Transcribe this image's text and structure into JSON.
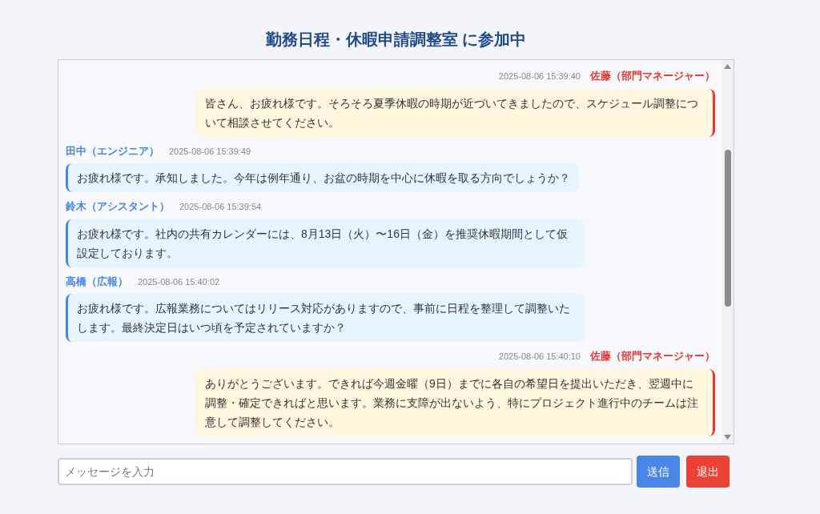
{
  "title": "勤務日程・休暇申請調整室 に参加中",
  "messages": [
    {
      "kind": "self",
      "sender": "佐藤（部門マネージャー）",
      "time": "2025-08-06 15:39:40",
      "text": "皆さん、お疲れ様です。そろそろ夏季休暇の時期が近づいてきましたので、スケジュール調整について相談させてください。"
    },
    {
      "kind": "other",
      "sender": "田中（エンジニア）",
      "time": "2025-08-06 15:39:49",
      "text": "お疲れ様です。承知しました。今年は例年通り、お盆の時期を中心に休暇を取る方向でしょうか？"
    },
    {
      "kind": "other",
      "sender": "鈴木（アシスタント）",
      "time": "2025-08-06 15:39:54",
      "text": "お疲れ様です。社内の共有カレンダーには、8月13日（火）〜16日（金）を推奨休暇期間として仮設定しております。"
    },
    {
      "kind": "other",
      "sender": "高橋（広報）",
      "time": "2025-08-06 15:40:02",
      "text": "お疲れ様です。広報業務についてはリリース対応がありますので、事前に日程を整理して調整いたします。最終決定日はいつ頃を予定されていますか？"
    },
    {
      "kind": "self",
      "sender": "佐藤（部門マネージャー）",
      "time": "2025-08-06 15:40:10",
      "text": "ありがとうございます。できれば今週金曜（9日）までに各自の希望日を提出いただき、翌週中に調整・確定できればと思います。業務に支障が出ないよう、特にプロジェクト進行中のチームは注意して調整してください。"
    }
  ],
  "input": {
    "placeholder": "メッセージを入力"
  },
  "buttons": [
    {
      "kind": "send",
      "label": "送信"
    },
    {
      "kind": "exit",
      "label": "退出"
    }
  ]
}
